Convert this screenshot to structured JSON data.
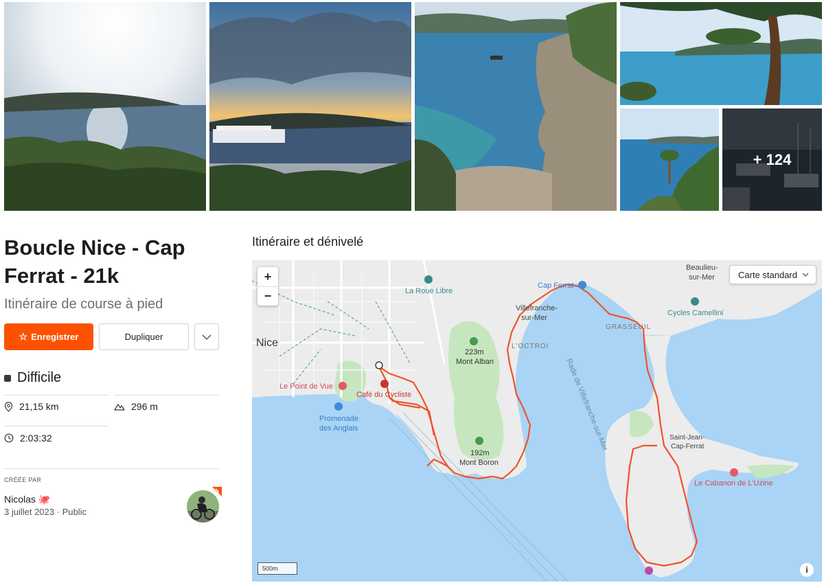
{
  "gallery": {
    "more_count": "+ 124"
  },
  "route": {
    "title": "Boucle Nice - Cap Ferrat - 21k",
    "subtitle": "Itinéraire de course à pied",
    "save_label": "Enregistrer",
    "duplicate_label": "Dupliquer",
    "difficulty": "Difficile",
    "distance": "21,15 km",
    "elevation": "296 m",
    "duration": "2:03:32"
  },
  "creator": {
    "label": "CRÉÉE PAR",
    "name": "Nicolas 🐙",
    "date": "3 juillet 2023",
    "visibility": "Public"
  },
  "map": {
    "section_title": "Itinéraire et dénivelé",
    "style_select": "Carte standard",
    "zoom_in": "+",
    "zoom_out": "−",
    "scale": "500m",
    "info": "i",
    "labels": {
      "nice": "Nice",
      "la_roue_libre": "La Roue Libre",
      "cap_ferrat": "Cap Ferrat",
      "villefranche": "Villefranche-",
      "villefranche2": "sur-Mer",
      "beaulieu": "Beaulieu-",
      "beaulieu2": "sur-Mer",
      "cycles_camellini": "Cycles Camellini",
      "grasseuil": "GRASSEUIL",
      "loctroi": "L'OCTROI",
      "mont_alban_h": "223m",
      "mont_alban": "Mont Alban",
      "mont_boron_h": "192m",
      "mont_boron": "Mont Boron",
      "le_point_de_vue": "Le Point de Vue",
      "cafe_du_cycliste": "Café du Cycliste",
      "promenade": "Promenade",
      "promenade2": "des Anglais",
      "rade": "Rade de Villefranche-sur-Mer",
      "saint_jean": "Saint-Jean-",
      "saint_jean2": "Cap-Ferrat",
      "cabanon": "Le Cabanon de L'Uzine"
    }
  },
  "colors": {
    "accent": "#fc5200",
    "route": "#f0522a",
    "sea": "#a9d4f5",
    "land": "#ececec",
    "park": "#c6e6c0"
  }
}
